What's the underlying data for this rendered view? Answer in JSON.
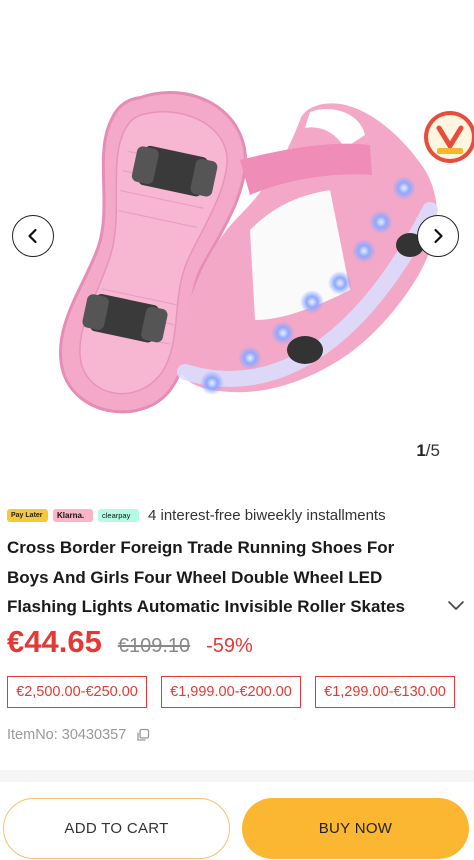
{
  "gallery": {
    "current": "1",
    "separator": "/",
    "total": "5",
    "icons": [
      "chevron-left-icon",
      "chevron-right-icon"
    ]
  },
  "payment": {
    "pills": [
      "Pay Later",
      "Klarna.",
      "clearpay"
    ],
    "text": "4 interest-free biweekly installments"
  },
  "product": {
    "title": "Cross Border Foreign Trade Running Shoes For Boys And Girls Four Wheel Double Wheel LED Flashing Lights Automatic Invisible Roller Skates",
    "price": "€44.65",
    "old_price": "€109.10",
    "discount": "-59%",
    "tiers": [
      "€2,500.00-€250.00",
      "€1,999.00-€200.00",
      "€1,299.00-€130.00"
    ],
    "item_no": "ItemNo: 30430357"
  },
  "actions": {
    "add_to_cart": "ADD TO CART",
    "buy_now": "BUY NOW"
  },
  "colors": {
    "price": "#e53935",
    "buy_button": "#fbb731",
    "cart_border": "#f4c26b"
  }
}
